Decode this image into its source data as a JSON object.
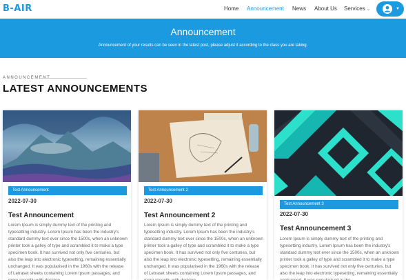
{
  "brand": {
    "logo": "B-AIR",
    "accent": "#1b9ae0"
  },
  "nav": {
    "home": "Home",
    "announcement": "Announcement",
    "news": "News",
    "about": "About Us",
    "services": "Services"
  },
  "hero": {
    "title": "Announcement",
    "subtitle": "Announcement of your results can be seen in the latest post, please adjust it according to the class you are taking."
  },
  "section": {
    "eyebrow": "ANNOUNCEMENT",
    "title": "LATEST ANNOUNCEMENTS"
  },
  "cards": [
    {
      "tag": "Test Announcement",
      "date": "2022-07-30",
      "title": "Test Announcement",
      "body": "Lorem Ipsum is simply dummy text of the printing and typesetting industry. Lorem Ipsum has been the industry's standard dummy text ever since the 1500s, when an unknown printer took a galley of type and scrambled it to make a type specimen book. It has survived not only five centuries, but also the leap into electronic typesetting, remaining essentially unchanged. It was popularised in the 1960s with the release of Letraset sheets containing Lorem Ipsum passages, and more recently with desktop"
    },
    {
      "tag": "Test Announcement 2",
      "date": "2022-07-30",
      "title": "Test Announcement 2",
      "body": "Lorem Ipsum is simply dummy text of the printing and typesetting industry. Lorem Ipsum has been the industry's standard dummy text ever since the 1500s, when an unknown printer took a galley of type and scrambled it to make a type specimen book. It has survived not only five centuries, but also the leap into electronic typesetting, remaining essentially unchanged. It was popularised in the 1960s with the release of Letraset sheets containing Lorem Ipsum passages, and more recently with desktop"
    },
    {
      "tag": "Test Announcement 3",
      "date": "2022-07-30",
      "title": "Test Announcement 3",
      "body": "Lorem Ipsum is simply dummy text of the printing and typesetting industry. Lorem Ipsum has been the industry's standard dummy text ever since the 1500s, when an unknown printer took a galley of type and scrambled it to make a type specimen book. It has survived not only five centuries, but also the leap into electronic typesetting, remaining essentially unchanged. It was popularised in the"
    }
  ]
}
